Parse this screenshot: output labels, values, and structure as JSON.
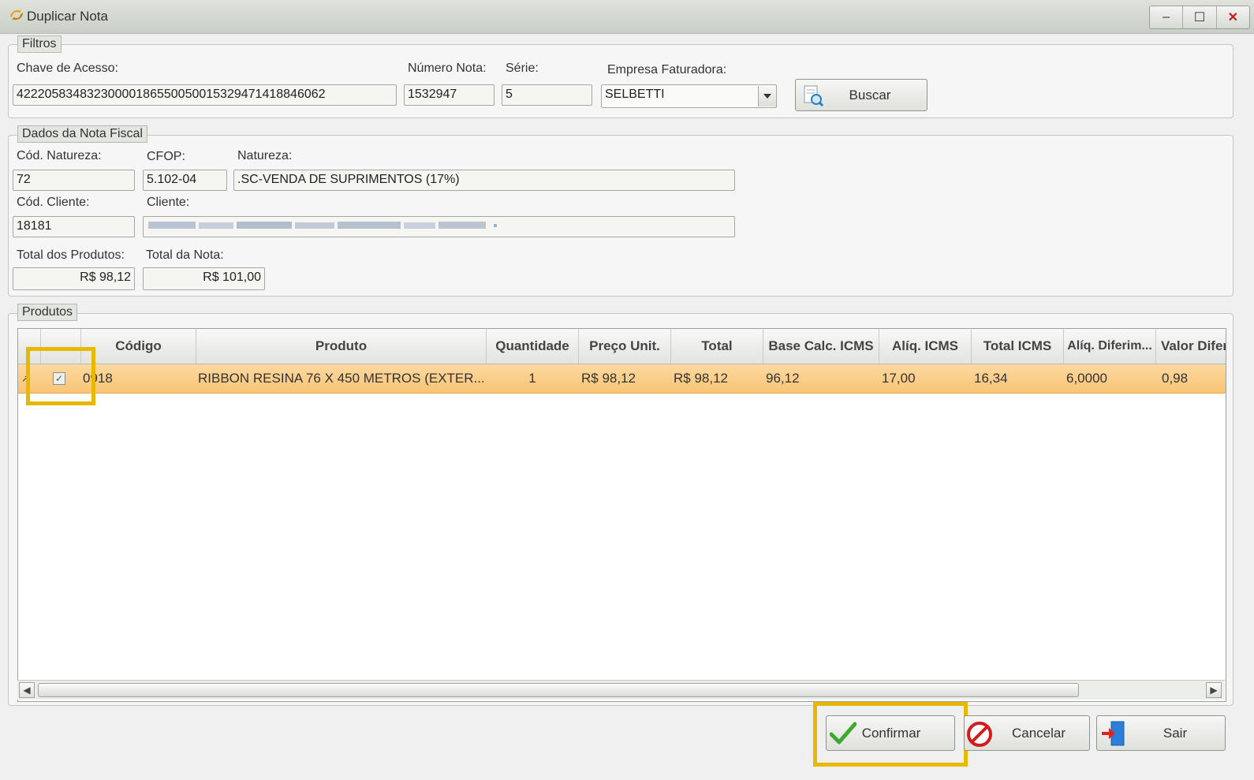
{
  "window": {
    "title": "Duplicar Nota",
    "minimize": "–",
    "maximize": "☐",
    "close": "✕"
  },
  "filtros": {
    "legend": "Filtros",
    "chave_label": "Chave de Acesso:",
    "chave_value": "42220583483230000186550050015329471418846062",
    "numero_label": "Número Nota:",
    "numero_value": "1532947",
    "serie_label": "Série:",
    "serie_value": "5",
    "empresa_label": "Empresa Faturadora:",
    "empresa_value": "SELBETTI",
    "buscar_label": "Buscar"
  },
  "dados": {
    "legend": "Dados da Nota Fiscal",
    "cod_natureza_label": "Cód. Natureza:",
    "cod_natureza_value": "72",
    "cfop_label": "CFOP:",
    "cfop_value": "5.102-04",
    "natureza_label": "Natureza:",
    "natureza_value": ".SC-VENDA DE SUPRIMENTOS (17%)",
    "cod_cliente_label": "Cód. Cliente:",
    "cod_cliente_value": "18181",
    "cliente_label": "Cliente:",
    "total_produtos_label": "Total dos Produtos:",
    "total_produtos_value": "R$ 98,12",
    "total_nota_label": "Total da Nota:",
    "total_nota_value": "R$ 101,00"
  },
  "produtos": {
    "legend": "Produtos",
    "columns": [
      "Código",
      "Produto",
      "Quantidade",
      "Preço Unit.",
      "Total",
      "Base Calc. ICMS",
      "Alíq. ICMS",
      "Total ICMS",
      "Alíq. Diferim...",
      "Valor Difer"
    ],
    "rows": [
      {
        "indicator": "↗",
        "checked": "✓",
        "codigo": "0918",
        "produto": "RIBBON RESINA 76 X 450 METROS (EXTER...",
        "quantidade": "1",
        "preco_unit": "R$ 98,12",
        "total": "R$ 98,12",
        "base_calc_icms": "96,12",
        "aliq_icms": "17,00",
        "total_icms": "16,34",
        "aliq_diferim": "6,0000",
        "valor_difer": "0,98"
      }
    ]
  },
  "actions": {
    "confirmar": "Confirmar",
    "cancelar": "Cancelar",
    "sair": "Sair"
  },
  "colors": {
    "row_selected": "#f9c476",
    "highlight": "#e6b800"
  }
}
